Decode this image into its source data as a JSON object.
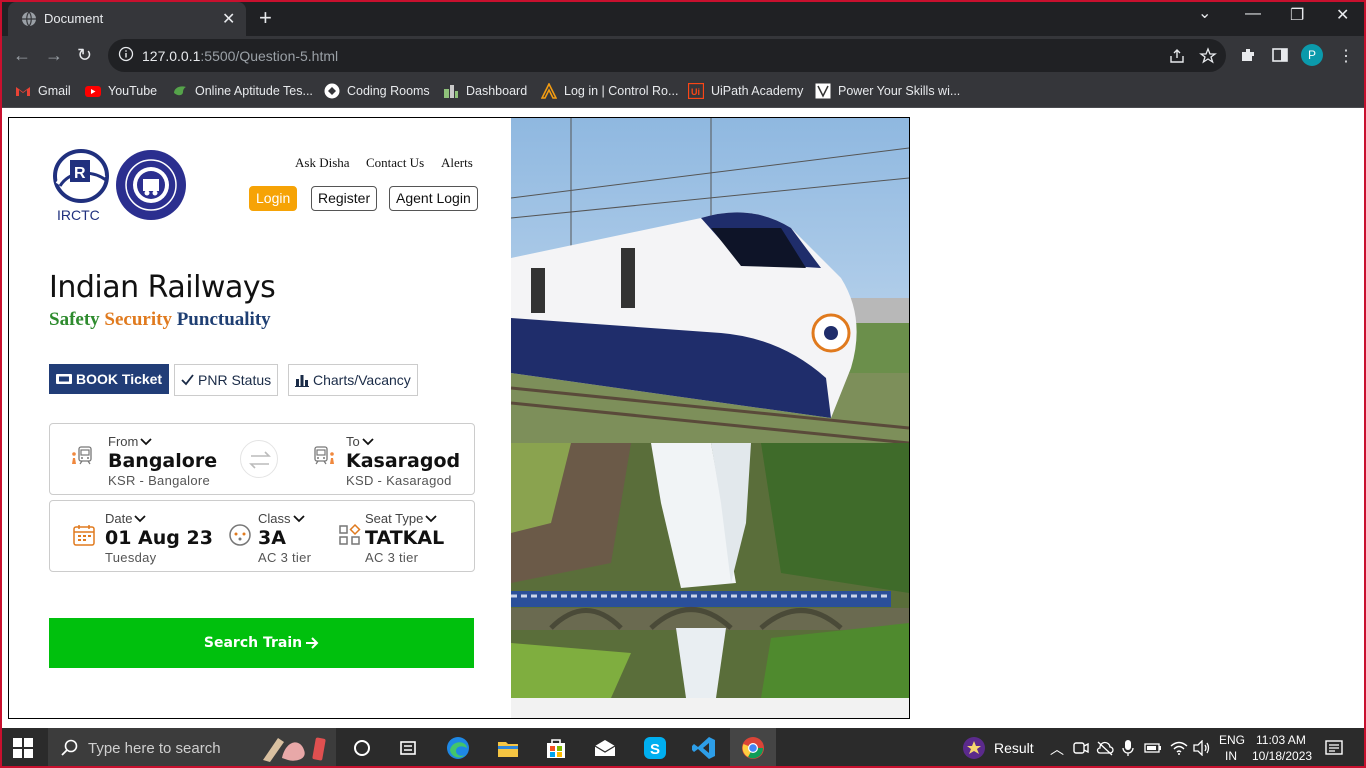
{
  "browser": {
    "tab_title": "Document",
    "url_host": "127.0.0.1",
    "url_rest": ":5500/Question-5.html",
    "profile_initial": "P",
    "bookmarks": [
      {
        "label": "Gmail",
        "icon": "gmail-icon"
      },
      {
        "label": "YouTube",
        "icon": "youtube-icon"
      },
      {
        "label": "Online Aptitude Tes...",
        "icon": "aptitude-icon"
      },
      {
        "label": "Coding Rooms",
        "icon": "coding-rooms-icon"
      },
      {
        "label": "Dashboard",
        "icon": "dashboard-icon"
      },
      {
        "label": "Log in | Control Ro...",
        "icon": "control-room-icon"
      },
      {
        "label": "UiPath Academy",
        "icon": "uipath-icon"
      },
      {
        "label": "Power Your Skills wi...",
        "icon": "skills-icon"
      }
    ]
  },
  "page": {
    "logo_text": "IRCTC",
    "top_links": [
      "Ask Disha",
      "Contact Us",
      "Alerts"
    ],
    "auth_buttons": {
      "login": "Login",
      "register": "Register",
      "agent": "Agent Login"
    },
    "heading": "Indian Railways",
    "tagline": {
      "safety": "Safety",
      "security": "Security",
      "punctuality": "Punctuality"
    },
    "options": {
      "book": "BOOK Ticket",
      "pnr": "PNR Status",
      "charts": "Charts/Vacancy"
    },
    "from": {
      "label": "From",
      "value": "Bangalore",
      "sub": "KSR - Bangalore"
    },
    "to": {
      "label": "To",
      "value": "Kasaragod",
      "sub": "KSD - Kasaragod"
    },
    "date": {
      "label": "Date",
      "value": "01 Aug 23",
      "sub": "Tuesday"
    },
    "class": {
      "label": "Class",
      "value": "3A",
      "sub": "AC 3 tier"
    },
    "seat": {
      "label": "Seat Type",
      "value": "TATKAL",
      "sub": "AC 3 tier"
    },
    "search_button": "Search Train",
    "colors": {
      "login": "#f6a306",
      "book": "#213d77",
      "search": "#00c00d",
      "safety": "#2e8b2e",
      "security": "#e07a1e",
      "punctuality": "#1f3f73"
    }
  },
  "taskbar": {
    "search_placeholder": "Type here to search",
    "result_label": "Result",
    "lang_top": "ENG",
    "lang_bottom": "IN",
    "time": "11:03 AM",
    "date": "10/18/2023"
  }
}
